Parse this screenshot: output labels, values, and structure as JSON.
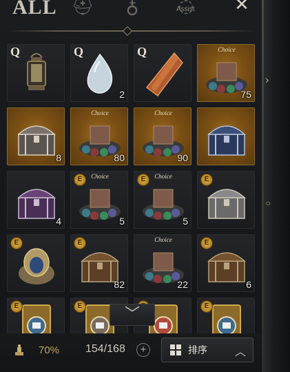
{
  "tabs": {
    "all_label": "ALL",
    "assist_label": "Assist",
    "icons": [
      "helmet-icon",
      "pouch-icon",
      "assist-icon"
    ]
  },
  "slots": [
    {
      "name": "lantern",
      "badge": "Q",
      "count": "",
      "choice": "",
      "bg": "dark"
    },
    {
      "name": "water-drop",
      "badge": "Q",
      "count": "2",
      "choice": "",
      "bg": "dark"
    },
    {
      "name": "amber-crystal",
      "badge": "Q",
      "count": "",
      "choice": "",
      "bg": "dark"
    },
    {
      "name": "choice-gear-pile",
      "badge": "",
      "count": "75",
      "choice": "Choice",
      "bg": "gold"
    },
    {
      "name": "ornate-chest",
      "badge": "",
      "count": "8",
      "choice": "",
      "bg": "gold"
    },
    {
      "name": "choice-gem-pile",
      "badge": "",
      "count": "80",
      "choice": "Choice",
      "bg": "gold"
    },
    {
      "name": "choice-armor-set",
      "badge": "",
      "count": "90",
      "choice": "Choice",
      "bg": "gold"
    },
    {
      "name": "blue-chest",
      "badge": "",
      "count": "",
      "choice": "",
      "bg": "gold"
    },
    {
      "name": "purple-chest",
      "badge": "",
      "count": "4",
      "choice": "",
      "bg": "dark"
    },
    {
      "name": "choice-armor-set-2",
      "badge": "E",
      "count": "5",
      "choice": "Choice",
      "bg": "dark"
    },
    {
      "name": "choice-gear-pile-2",
      "badge": "E",
      "count": "5",
      "choice": "Choice",
      "bg": "dark"
    },
    {
      "name": "silver-chest",
      "badge": "E",
      "count": "",
      "choice": "",
      "bg": "dark"
    },
    {
      "name": "armor-bust",
      "badge": "E",
      "count": "",
      "choice": "",
      "bg": "dark"
    },
    {
      "name": "wooden-chest",
      "badge": "E",
      "count": "82",
      "choice": "",
      "bg": "dark"
    },
    {
      "name": "choice-gem-chest",
      "badge": "",
      "count": "22",
      "choice": "Choice",
      "bg": "dark"
    },
    {
      "name": "wooden-chest-2",
      "badge": "E",
      "count": "6",
      "choice": "",
      "bg": "dark"
    },
    {
      "name": "card-blue",
      "badge": "E",
      "count": "",
      "choice": "",
      "bg": "dark"
    },
    {
      "name": "card-portrait",
      "badge": "E",
      "count": "",
      "choice": "",
      "bg": "dark"
    },
    {
      "name": "card-red",
      "badge": "E",
      "count": "",
      "choice": "",
      "bg": "dark"
    },
    {
      "name": "card-envelope",
      "badge": "E",
      "count": "",
      "choice": "",
      "bg": "dark"
    }
  ],
  "bottom": {
    "weight": "70%",
    "capacity": "154/168",
    "add_glyph": "+",
    "sort_label": "排序",
    "sort_chevron": "︿",
    "scroll_glyph": "﹀"
  },
  "colors": {
    "panel": "#1a1c1f",
    "gold_slot": "#7a4f14",
    "accent": "#c2a45f"
  }
}
